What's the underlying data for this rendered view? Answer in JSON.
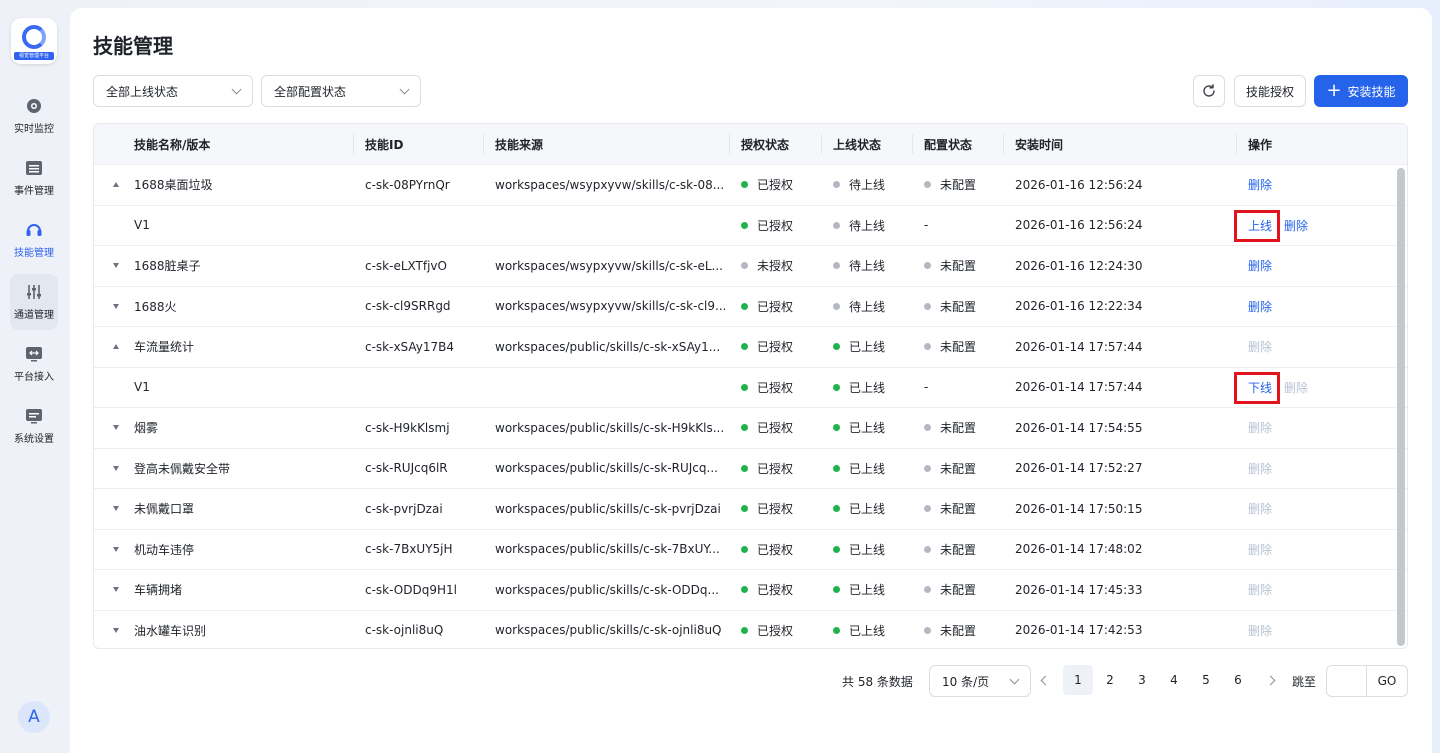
{
  "sidebar": {
    "logo_text": "视觉管理平台",
    "items": [
      {
        "label": "实时监控",
        "icon": "camera-icon"
      },
      {
        "label": "事件管理",
        "icon": "folder-list-icon"
      },
      {
        "label": "技能管理",
        "icon": "headset-icon"
      },
      {
        "label": "通道管理",
        "icon": "sliders-icon"
      },
      {
        "label": "平台接入",
        "icon": "monitor-arrows-icon"
      },
      {
        "label": "系统设置",
        "icon": "monitor-settings-icon"
      }
    ],
    "active_index": 2,
    "hover_index": 3,
    "avatar": "A"
  },
  "page": {
    "title": "技能管理"
  },
  "filters": {
    "online_status": "全部上线状态",
    "config_status": "全部配置状态"
  },
  "toolbar": {
    "refresh_icon": "refresh-icon",
    "authorize_label": "技能授权",
    "install_label": "安装技能"
  },
  "table": {
    "columns": [
      "技能名称/版本",
      "技能ID",
      "技能来源",
      "授权状态",
      "上线状态",
      "配置状态",
      "安装时间",
      "操作"
    ],
    "rows": [
      {
        "expand": "up",
        "name": "1688桌面垃圾",
        "id": "c-sk-08PYrnQr",
        "source": "workspaces/wsypxyvw/skills/c-sk-08...",
        "auth": "已授权",
        "auth_color": "green",
        "online": "待上线",
        "online_color": "gray",
        "config": "未配置",
        "config_dot": true,
        "time": "2026-01-16 12:56:24",
        "actions": [
          {
            "label": "删除",
            "disabled": false
          }
        ]
      },
      {
        "expand": "",
        "name": "V1",
        "id": "",
        "source": "",
        "auth": "已授权",
        "auth_color": "green",
        "online": "待上线",
        "online_color": "gray",
        "config": "-",
        "config_dot": false,
        "time": "2026-01-16 12:56:24",
        "actions": [
          {
            "label": "上线",
            "disabled": false,
            "highlight": true
          },
          {
            "label": "删除",
            "disabled": false
          }
        ]
      },
      {
        "expand": "down",
        "name": "1688脏桌子",
        "id": "c-sk-eLXTfjvO",
        "source": "workspaces/wsypxyvw/skills/c-sk-eL...",
        "auth": "未授权",
        "auth_color": "gray",
        "online": "待上线",
        "online_color": "gray",
        "config": "未配置",
        "config_dot": true,
        "time": "2026-01-16 12:24:30",
        "actions": [
          {
            "label": "删除",
            "disabled": false
          }
        ]
      },
      {
        "expand": "down",
        "name": "1688火",
        "id": "c-sk-cl9SRRgd",
        "source": "workspaces/wsypxyvw/skills/c-sk-cl9...",
        "auth": "已授权",
        "auth_color": "green",
        "online": "待上线",
        "online_color": "gray",
        "config": "未配置",
        "config_dot": true,
        "time": "2026-01-16 12:22:34",
        "actions": [
          {
            "label": "删除",
            "disabled": false
          }
        ]
      },
      {
        "expand": "up",
        "name": "车流量统计",
        "id": "c-sk-xSAy17B4",
        "source": "workspaces/public/skills/c-sk-xSAy1...",
        "auth": "已授权",
        "auth_color": "green",
        "online": "已上线",
        "online_color": "green",
        "config": "未配置",
        "config_dot": true,
        "time": "2026-01-14 17:57:44",
        "actions": [
          {
            "label": "删除",
            "disabled": true
          }
        ]
      },
      {
        "expand": "",
        "name": "V1",
        "id": "",
        "source": "",
        "auth": "已授权",
        "auth_color": "green",
        "online": "已上线",
        "online_color": "green",
        "config": "-",
        "config_dot": false,
        "time": "2026-01-14 17:57:44",
        "actions": [
          {
            "label": "下线",
            "disabled": false,
            "highlight": true
          },
          {
            "label": "删除",
            "disabled": true
          }
        ]
      },
      {
        "expand": "down",
        "name": "烟雾",
        "id": "c-sk-H9kKlsmj",
        "source": "workspaces/public/skills/c-sk-H9kKls...",
        "auth": "已授权",
        "auth_color": "green",
        "online": "已上线",
        "online_color": "green",
        "config": "未配置",
        "config_dot": true,
        "time": "2026-01-14 17:54:55",
        "actions": [
          {
            "label": "删除",
            "disabled": true
          }
        ]
      },
      {
        "expand": "down",
        "name": "登高未佩戴安全带",
        "id": "c-sk-RUJcq6lR",
        "source": "workspaces/public/skills/c-sk-RUJcq...",
        "auth": "已授权",
        "auth_color": "green",
        "online": "已上线",
        "online_color": "green",
        "config": "未配置",
        "config_dot": true,
        "time": "2026-01-14 17:52:27",
        "actions": [
          {
            "label": "删除",
            "disabled": true
          }
        ]
      },
      {
        "expand": "down",
        "name": "未佩戴口罩",
        "id": "c-sk-pvrjDzai",
        "source": "workspaces/public/skills/c-sk-pvrjDzai",
        "auth": "已授权",
        "auth_color": "green",
        "online": "已上线",
        "online_color": "green",
        "config": "未配置",
        "config_dot": true,
        "time": "2026-01-14 17:50:15",
        "actions": [
          {
            "label": "删除",
            "disabled": true
          }
        ]
      },
      {
        "expand": "down",
        "name": "机动车违停",
        "id": "c-sk-7BxUY5jH",
        "source": "workspaces/public/skills/c-sk-7BxUY...",
        "auth": "已授权",
        "auth_color": "green",
        "online": "已上线",
        "online_color": "green",
        "config": "未配置",
        "config_dot": true,
        "time": "2026-01-14 17:48:02",
        "actions": [
          {
            "label": "删除",
            "disabled": true
          }
        ]
      },
      {
        "expand": "down",
        "name": "车辆拥堵",
        "id": "c-sk-ODDq9H1l",
        "source": "workspaces/public/skills/c-sk-ODDq...",
        "auth": "已授权",
        "auth_color": "green",
        "online": "已上线",
        "online_color": "green",
        "config": "未配置",
        "config_dot": true,
        "time": "2026-01-14 17:45:33",
        "actions": [
          {
            "label": "删除",
            "disabled": true
          }
        ]
      },
      {
        "expand": "down",
        "name": "油水罐车识别",
        "id": "c-sk-ojnli8uQ",
        "source": "workspaces/public/skills/c-sk-ojnli8uQ",
        "auth": "已授权",
        "auth_color": "green",
        "online": "已上线",
        "online_color": "green",
        "config": "未配置",
        "config_dot": true,
        "time": "2026-01-14 17:42:53",
        "actions": [
          {
            "label": "删除",
            "disabled": true
          }
        ]
      }
    ]
  },
  "pagination": {
    "total_text": "共 58 条数据",
    "page_size": "10 条/页",
    "pages": [
      "1",
      "2",
      "3",
      "4",
      "5",
      "6"
    ],
    "current": "1",
    "jump_label": "跳至",
    "jump_value": "",
    "go_label": "GO"
  },
  "colors": {
    "accent": "#2563eb",
    "status_green": "#22b24c",
    "status_gray": "#b3b8c2",
    "highlight_red": "#e1141d"
  }
}
